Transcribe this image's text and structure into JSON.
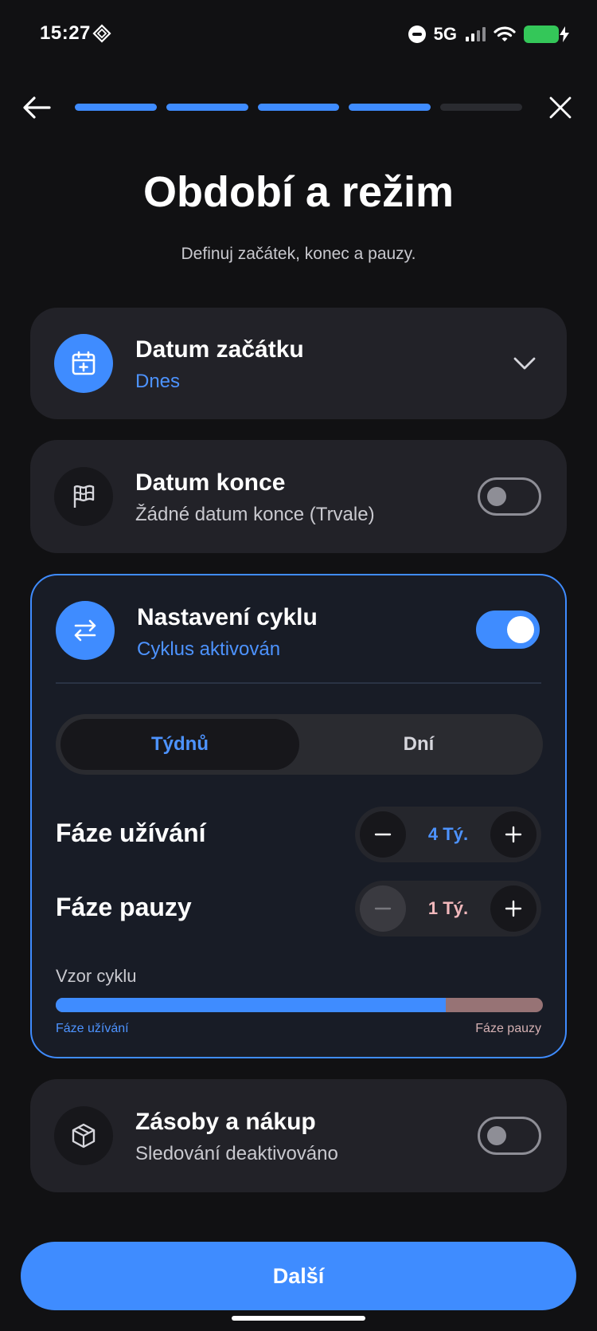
{
  "status_bar": {
    "time": "15:27",
    "network": "5G",
    "icons": [
      "app-diamond-icon",
      "do-not-disturb-icon",
      "cellular-signal-icon",
      "wifi-icon",
      "battery-charging-icon"
    ],
    "battery_color": "#34c759"
  },
  "header": {
    "back_icon": "arrow-left-icon",
    "close_icon": "close-icon",
    "progress": {
      "total_steps": 5,
      "completed_steps": 4
    }
  },
  "page": {
    "title": "Období a režim",
    "subtitle": "Definuj začátek, konec a pauzy."
  },
  "start_date": {
    "title": "Datum začátku",
    "value": "Dnes",
    "icon": "calendar-plus-icon"
  },
  "end_date": {
    "title": "Datum konce",
    "value": "Žádné datum konce (Trvale)",
    "icon": "flag-icon",
    "enabled": false
  },
  "cycle": {
    "title": "Nastavení cyklu",
    "status": "Cyklus aktivován",
    "icon": "swap-arrows-icon",
    "enabled": true,
    "unit_tabs": [
      {
        "label": "Týdnů",
        "active": true
      },
      {
        "label": "Dní",
        "active": false
      }
    ],
    "use_phase": {
      "label": "Fáze užívání",
      "value": "4 Tý.",
      "value_color": "#4d93ff"
    },
    "pause_phase": {
      "label": "Fáze pauzy",
      "value": "1 Tý.",
      "value_color": "#f2b8bc"
    },
    "pattern": {
      "title": "Vzor cyklu",
      "use_fraction": 0.8,
      "use_label": "Fáze užívání",
      "pause_label": "Fáze pauzy"
    }
  },
  "supplies": {
    "title": "Zásoby a nákup",
    "status": "Sledování deaktivováno",
    "icon": "package-icon",
    "enabled": false
  },
  "footer": {
    "next_label": "Další"
  },
  "colors": {
    "accent": "#3f8cff",
    "background": "#111113",
    "card": "#222228",
    "pause": "#977375"
  }
}
